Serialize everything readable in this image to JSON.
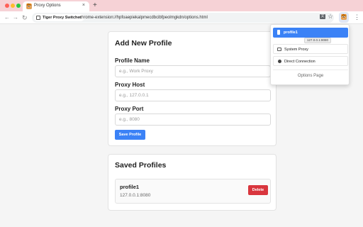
{
  "browser": {
    "tab_title": "Proxy Options",
    "tab_close": "×",
    "new_tab": "+",
    "favicon_glyph": "🐯",
    "nav": {
      "back": "←",
      "forward": "→",
      "reload": "↻"
    },
    "address": {
      "chip_label": "Tiger Proxy Switcher",
      "url": "chrome-extension://hpfoaepiekalpmecdbcibfpeolmgkdn/options.html"
    },
    "toolbar_icons": {
      "translate": "文",
      "star": "☆",
      "menu": "⋮"
    }
  },
  "add_profile": {
    "heading": "Add New Profile",
    "fields": [
      {
        "label": "Profile Name",
        "placeholder": "e.g., Work Proxy",
        "value": ""
      },
      {
        "label": "Proxy Host",
        "placeholder": "e.g., 127.0.0.1",
        "value": ""
      },
      {
        "label": "Proxy Port",
        "placeholder": "e.g., 8080",
        "value": ""
      }
    ],
    "save_label": "Save Profile"
  },
  "saved_profiles": {
    "heading": "Saved Profiles",
    "items": [
      {
        "name": "profile1",
        "address": "127.0.0.1:8080",
        "delete_label": "Delete"
      }
    ]
  },
  "popup": {
    "active_profile": "profile1",
    "active_tooltip": "127.0.0.1:8080",
    "system_proxy": "System Proxy",
    "direct_connection": "Direct Connection",
    "options_page": "Options Page"
  },
  "colors": {
    "accent": "#3b82f6",
    "danger": "#d9363e",
    "tabstrip": "#f6d2d6"
  }
}
